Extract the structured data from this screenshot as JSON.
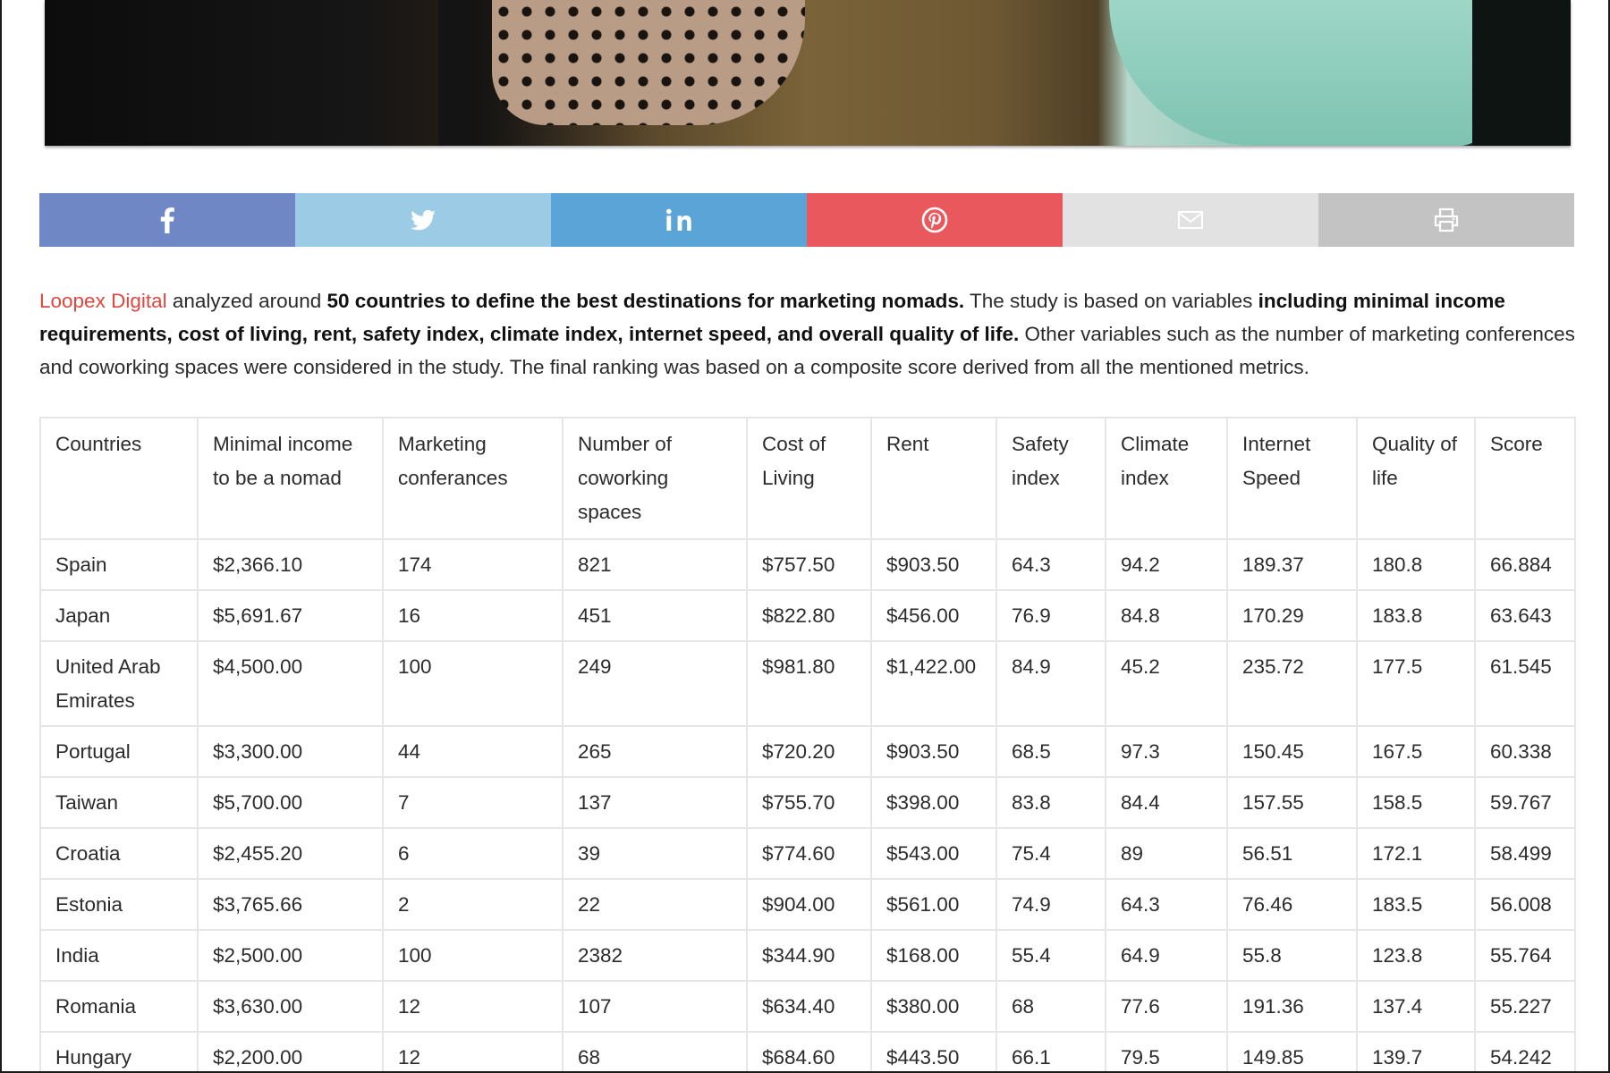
{
  "share_bar": [
    {
      "icon": "facebook-icon",
      "color": "#6f87c5"
    },
    {
      "icon": "twitter-icon",
      "color": "#9ccbe6"
    },
    {
      "icon": "linkedin-icon",
      "color": "#5aa4d8"
    },
    {
      "icon": "pinterest-icon",
      "color": "#e9585c"
    },
    {
      "icon": "email-icon",
      "color": "#e2e2e2"
    },
    {
      "icon": "print-icon",
      "color": "#c3c3c3"
    }
  ],
  "intro": {
    "brand": "Loopex Digital",
    "t1": " analyzed around ",
    "b1": "50 countries to define the best destinations for marketing nomads.",
    "t2": " The study is based on variables ",
    "b2": "including minimal income requirements, cost of living, rent, safety index, climate index, internet speed, and overall quality of life.",
    "t3": " Other variables such as the number of marketing conferences and coworking spaces were considered in the study. The final ranking was based on a composite score derived from all the mentioned metrics."
  },
  "table": {
    "headers": [
      "Countries",
      "Minimal income to be a nomad",
      "Marketing conferances",
      "Number of coworking spaces",
      "Cost of Living",
      "Rent",
      "Safety index",
      "Climate index",
      "Internet Speed",
      "Quality of life",
      "Score"
    ],
    "rows": [
      [
        "Spain",
        "$2,366.10",
        "174",
        "821",
        "$757.50",
        "$903.50",
        "64.3",
        "94.2",
        "189.37",
        "180.8",
        "66.884"
      ],
      [
        "Japan",
        "$5,691.67",
        "16",
        "451",
        "$822.80",
        "$456.00",
        "76.9",
        "84.8",
        "170.29",
        "183.8",
        "63.643"
      ],
      [
        "United Arab Emirates",
        "$4,500.00",
        "100",
        "249",
        "$981.80",
        "$1,422.00",
        "84.9",
        "45.2",
        "235.72",
        "177.5",
        "61.545"
      ],
      [
        "Portugal",
        "$3,300.00",
        "44",
        "265",
        "$720.20",
        "$903.50",
        "68.5",
        "97.3",
        "150.45",
        "167.5",
        "60.338"
      ],
      [
        "Taiwan",
        "$5,700.00",
        "7",
        "137",
        "$755.70",
        "$398.00",
        "83.8",
        "84.4",
        "157.55",
        "158.5",
        "59.767"
      ],
      [
        "Croatia",
        "$2,455.20",
        "6",
        "39",
        "$774.60",
        "$543.00",
        "75.4",
        "89",
        "56.51",
        "172.1",
        "58.499"
      ],
      [
        "Estonia",
        "$3,765.66",
        "2",
        "22",
        "$904.00",
        "$561.00",
        "74.9",
        "64.3",
        "76.46",
        "183.5",
        "56.008"
      ],
      [
        "India",
        "$2,500.00",
        "100",
        "2382",
        "$344.90",
        "$168.00",
        "55.4",
        "64.9",
        "55.8",
        "123.8",
        "55.764"
      ],
      [
        "Romania",
        "$3,630.00",
        "12",
        "107",
        "$634.40",
        "$380.00",
        "68",
        "77.6",
        "191.36",
        "137.4",
        "55.227"
      ],
      [
        "Hungary",
        "$2,200.00",
        "12",
        "68",
        "$684.60",
        "$443.50",
        "66.1",
        "79.5",
        "149.85",
        "139.7",
        "54.242"
      ]
    ]
  }
}
